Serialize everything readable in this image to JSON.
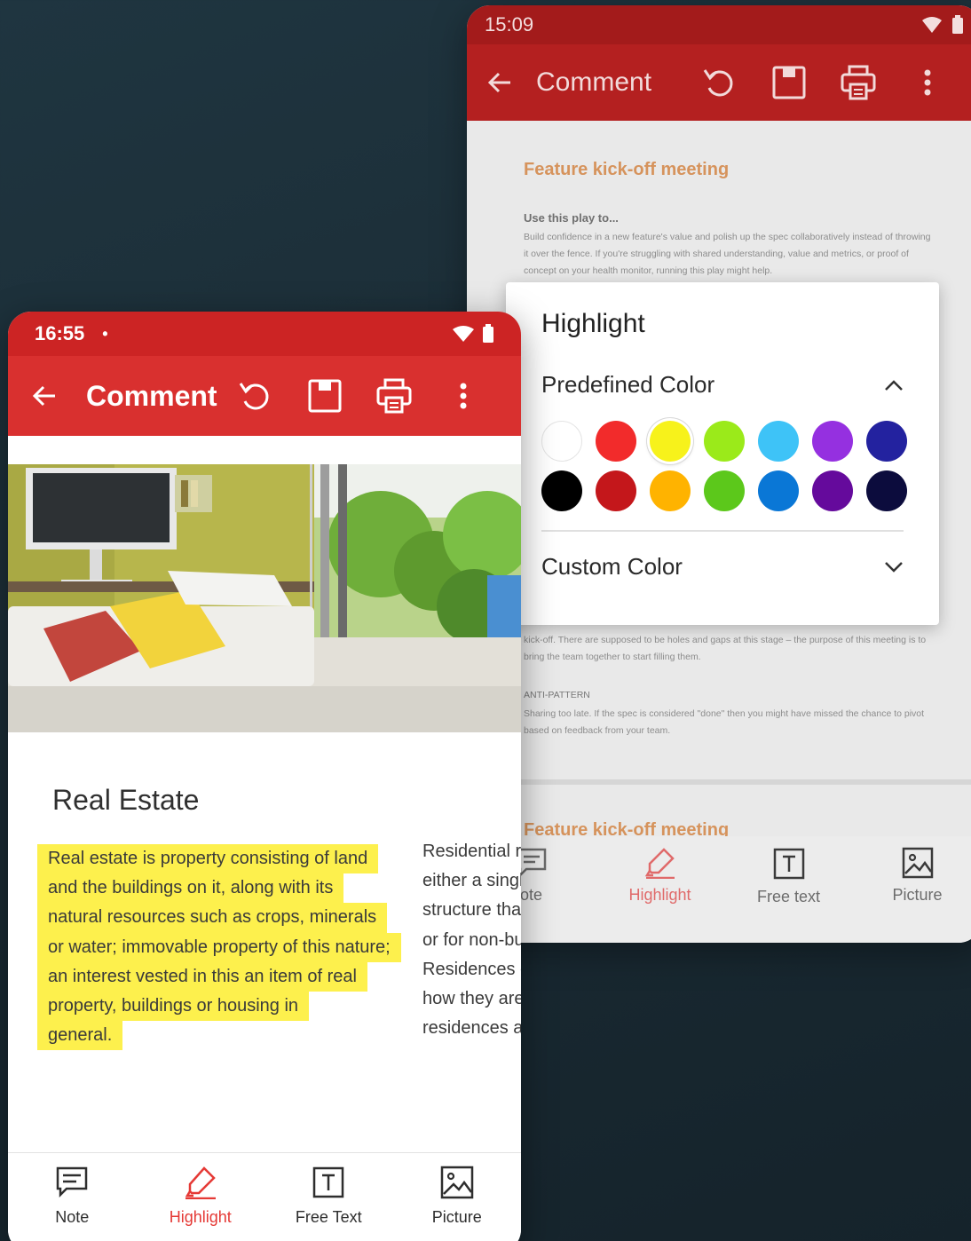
{
  "back_phone": {
    "status_time": "15:09",
    "toolbar_title": "Comment",
    "doc": {
      "heading": "Feature kick-off meeting",
      "subheading": "Use this play to...",
      "para1": "Build confidence in a new feature's value and polish up the spec collaboratively instead of throwing it over the fence. If you're struggling with shared understanding, value and metrics, or proof of concept on your health monitor, running this play might help.",
      "para2": "kick-off. There are supposed to be holes and gaps at this stage – the purpose of this meeting is to bring the team together to start filling them.",
      "anti_label": "ANTI-PATTERN",
      "anti_text": "Sharing too late. If the spec is considered \"done\" then you might have missed the chance to pivot based on feedback from your team.",
      "heading2": "Feature kick-off meeting"
    },
    "bottom_tools": [
      {
        "label": "ote",
        "icon": "note-icon"
      },
      {
        "label": "Highlight",
        "icon": "highlighter-icon",
        "active": true
      },
      {
        "label": "Free text",
        "icon": "free-text-icon"
      },
      {
        "label": "Picture",
        "icon": "picture-icon"
      }
    ]
  },
  "popup": {
    "title": "Highlight",
    "predefined_label": "Predefined Color",
    "custom_label": "Custom Color",
    "selected_color": "#f7f21b",
    "colors": [
      "#ffffff",
      "#f22b2b",
      "#f7f21b",
      "#9bea1a",
      "#3ec3f7",
      "#9530e0",
      "#23229f",
      "#000000",
      "#c4171b",
      "#ffb300",
      "#5cc81b",
      "#0a77d6",
      "#650a9c",
      "#0c0c3d"
    ]
  },
  "front_phone": {
    "status_time": "16:55",
    "status_dot": "•",
    "toolbar_title": "Comment",
    "heading": "Real Estate",
    "highlighted_lines": [
      "Real estate is property consisting of land",
      "and the buildings on it, along with its",
      "natural resources such as crops, minerals",
      "or water; immovable property of this nature;",
      "an interest vested in this an item of real",
      "property, buildings or housing in",
      "general."
    ],
    "column2_lines": [
      "Residential re",
      "either a singl",
      "structure tha",
      "or for non-bu",
      "Residences c",
      "how they are",
      "residences a"
    ],
    "bottom_tools": [
      {
        "label": "Note",
        "icon": "note-icon"
      },
      {
        "label": "Highlight",
        "icon": "highlighter-icon",
        "active": true
      },
      {
        "label": "Free Text",
        "icon": "free-text-icon"
      },
      {
        "label": "Picture",
        "icon": "picture-icon"
      }
    ],
    "accent_color": "#d9302f",
    "highlight_color": "#fdf04d"
  }
}
